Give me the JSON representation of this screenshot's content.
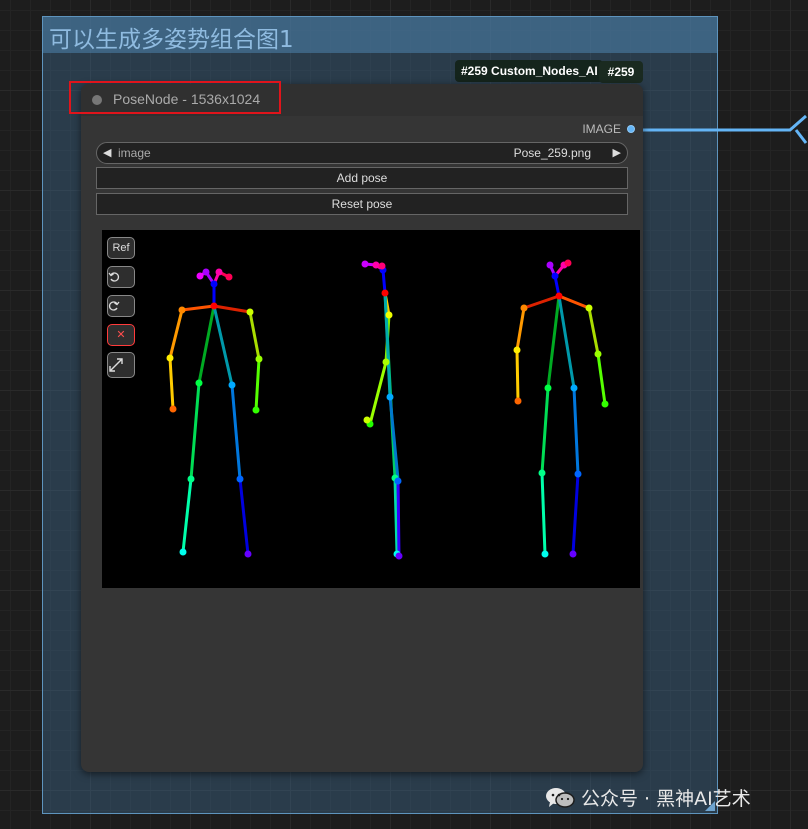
{
  "group": {
    "title": "可以生成多姿势组合图1"
  },
  "badges": {
    "title": "#259 Custom_Nodes_AI",
    "id": "#259"
  },
  "node": {
    "title": "PoseNode - 1536x1024",
    "output_label": "IMAGE",
    "image_combo": {
      "label": "image",
      "value": "Pose_259.png"
    },
    "add_pose_label": "Add pose",
    "reset_pose_label": "Reset pose"
  },
  "toolbar": {
    "ref_label": "Ref",
    "undo_icon": "undo-icon",
    "redo_icon": "redo-icon",
    "delete_icon": "close-icon",
    "fullscreen_icon": "expand-icon"
  },
  "watermark": {
    "text": "公众号 · 黑神AI艺术",
    "icon": "wechat-icon"
  },
  "colors": {
    "canvas_bg": "#1d1d1d",
    "group_bg": "#3e688c",
    "node_bg": "#353535",
    "link": "#64b5f6",
    "highlight": "#e0141b"
  }
}
